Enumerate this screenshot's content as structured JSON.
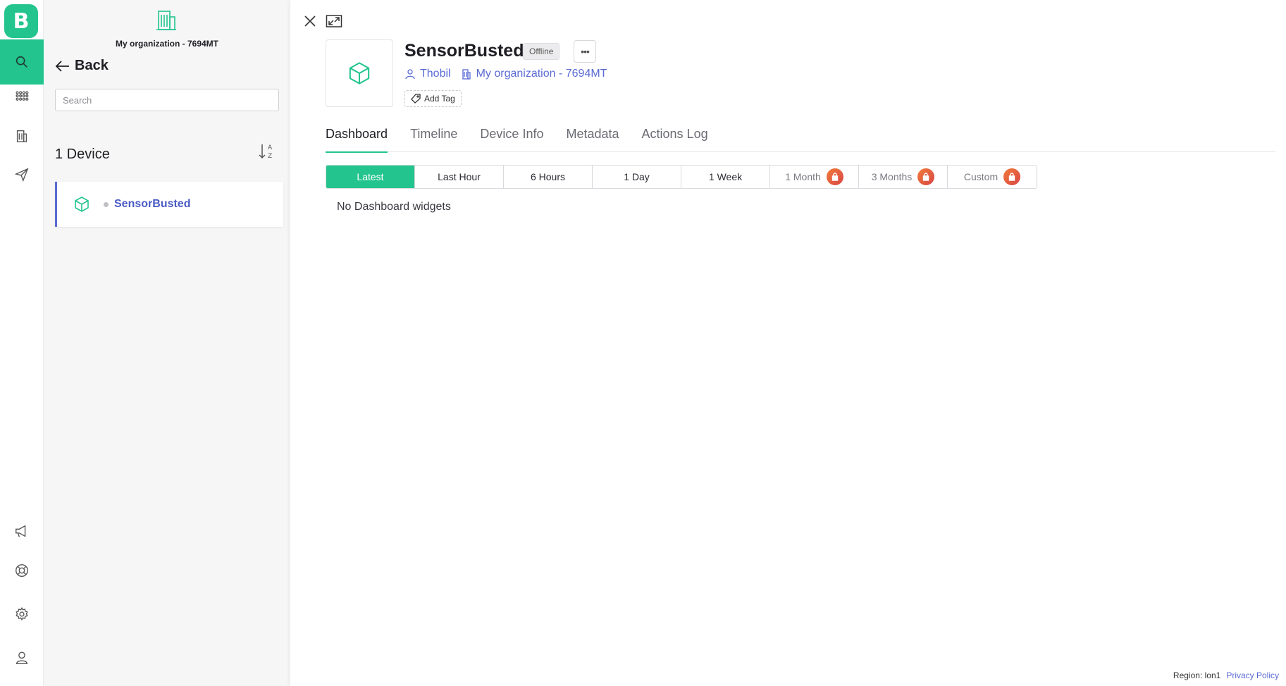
{
  "app": {
    "logo_letter": "B",
    "accent": "#23c48e",
    "link_color": "#5a6bd4"
  },
  "rail": {
    "top": [
      "search-icon",
      "apps-grid-icon",
      "building-icon",
      "send-icon"
    ],
    "bottom": [
      "megaphone-icon",
      "lifebuoy-icon",
      "gear-icon",
      "user-icon"
    ]
  },
  "panel": {
    "org_name": "My organization - 7694MT",
    "back_label": "Back",
    "search_placeholder": "Search",
    "device_count": "1 Device",
    "devices": [
      {
        "name": "SensorBusted",
        "status": "offline"
      }
    ]
  },
  "device": {
    "title": "SensorBusted",
    "status": "Offline",
    "owner": "Thobil",
    "organization": "My organization - 7694MT",
    "add_tag": "Add Tag"
  },
  "tabs": [
    "Dashboard",
    "Timeline",
    "Device Info",
    "Metadata",
    "Actions Log"
  ],
  "active_tab": "Dashboard",
  "ranges": [
    {
      "label": "Latest",
      "active": true,
      "locked": false
    },
    {
      "label": "Last Hour",
      "active": false,
      "locked": false
    },
    {
      "label": "6 Hours",
      "active": false,
      "locked": false
    },
    {
      "label": "1 Day",
      "active": false,
      "locked": false
    },
    {
      "label": "1 Week",
      "active": false,
      "locked": false
    },
    {
      "label": "1 Month",
      "active": false,
      "locked": true
    },
    {
      "label": "3 Months",
      "active": false,
      "locked": true
    },
    {
      "label": "Custom",
      "active": false,
      "locked": true
    }
  ],
  "empty_message": "No Dashboard widgets",
  "footer": {
    "region": "Region: lon1",
    "privacy": "Privacy Policy"
  }
}
